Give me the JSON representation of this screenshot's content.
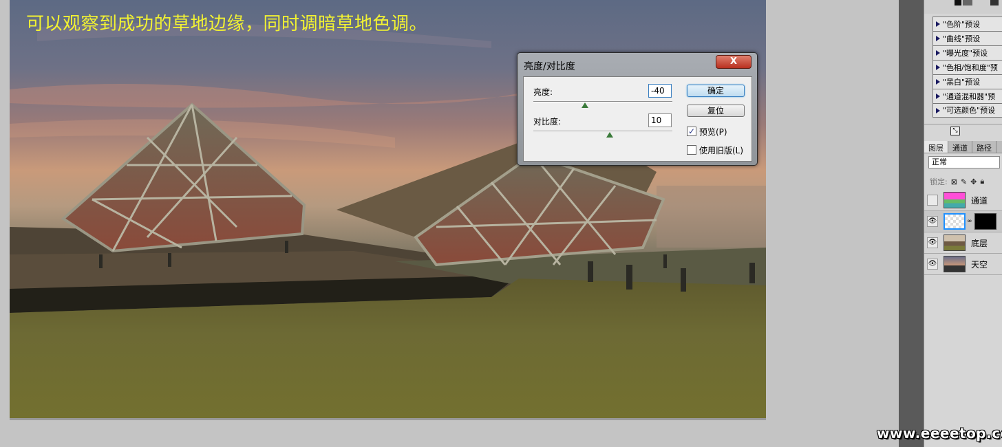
{
  "canvas": {
    "caption": "可以观察到成功的草地边缘，同时调暗草地色调。"
  },
  "dialog": {
    "title": "亮度/对比度",
    "close_label": "X",
    "brightness_label": "亮度:",
    "brightness_value": "-40",
    "contrast_label": "对比度:",
    "contrast_value": "10",
    "ok_label": "确定",
    "reset_label": "复位",
    "preview_label": "预览(P)",
    "preview_checked": true,
    "legacy_label": "使用旧版(L)",
    "legacy_checked": false
  },
  "presets": [
    {
      "label": "\"色阶\"预设"
    },
    {
      "label": "\"曲线\"预设"
    },
    {
      "label": "\"曝光度\"预设"
    },
    {
      "label": "\"色相/饱和度\"预"
    },
    {
      "label": "\"黑白\"预设"
    },
    {
      "label": "\"通道混和器\"预"
    },
    {
      "label": "\"可选颜色\"预设"
    }
  ],
  "layers_panel": {
    "tabs": [
      "图层",
      "通道",
      "路径"
    ],
    "active_tab": "图层",
    "blend_mode": "正常",
    "lock_label": "锁定:",
    "layers": [
      {
        "name": "通道",
        "visible": false
      },
      {
        "name": "",
        "visible": true,
        "selected": true
      },
      {
        "name": "底层",
        "visible": true
      },
      {
        "name": "天空",
        "visible": true
      }
    ]
  },
  "watermark": "www.eeeetop.com",
  "icons": {
    "eye": "eye-icon",
    "disclosure": "triangle-right-icon",
    "lock_transparent": "lock-transparent-icon",
    "lock_paint": "brush-icon",
    "lock_move": "move-icon",
    "lock_all": "lock-icon",
    "resize": "resize-icon"
  },
  "colors": {
    "caption": "#f2f232",
    "close_button": "#c03a28",
    "primary_button_glow": "#5ab0e8"
  }
}
